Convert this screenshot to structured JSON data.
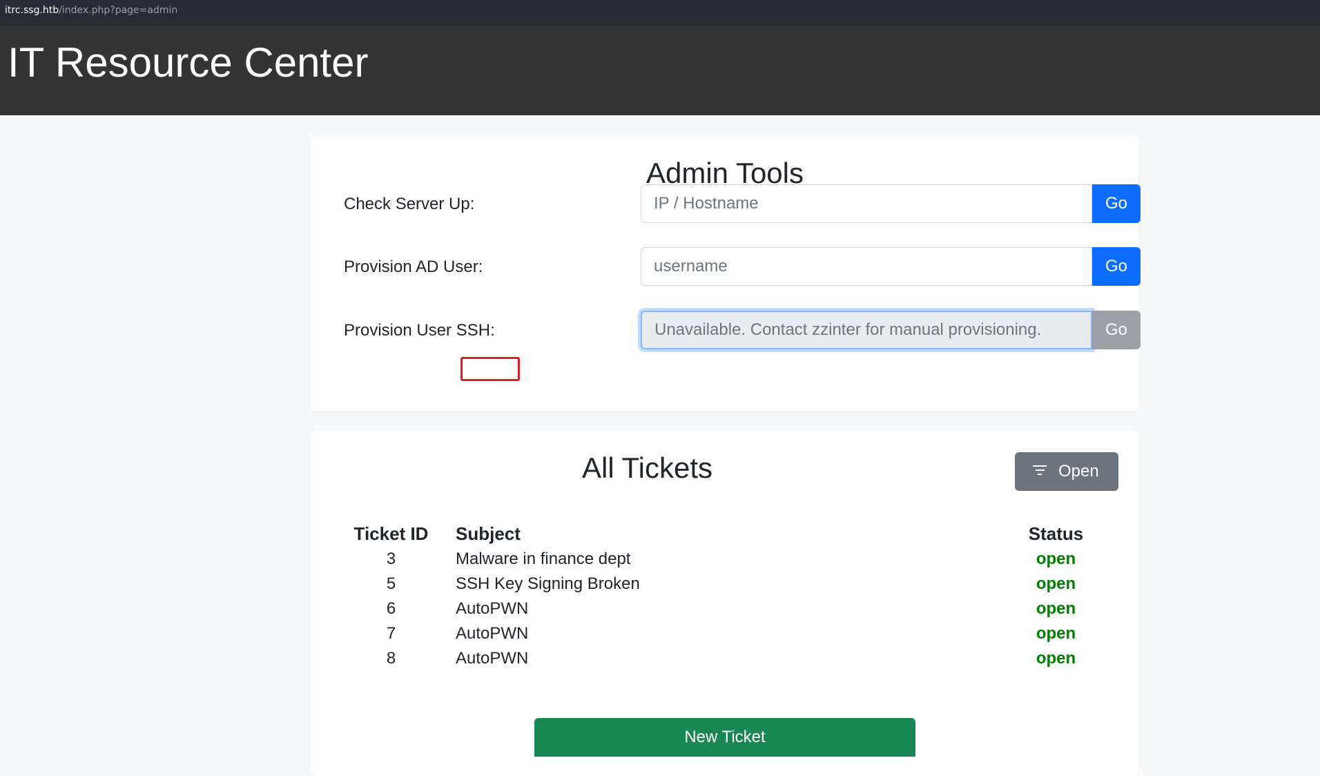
{
  "browser": {
    "url_host": "itrc.ssg.htb",
    "url_path": "/index.php?page=admin"
  },
  "header": {
    "title": "IT Resource Center"
  },
  "admin_tools": {
    "title": "Admin Tools",
    "rows": [
      {
        "label": "Check Server Up:",
        "placeholder": "IP / Hostname",
        "button": "Go"
      },
      {
        "label": "Provision AD User:",
        "placeholder": "username",
        "button": "Go"
      },
      {
        "label": "Provision User SSH:",
        "placeholder": "Unavailable. Contact zzinter for manual provisioning.",
        "button": "Go"
      }
    ]
  },
  "tickets": {
    "title": "All Tickets",
    "filter_label": "Open",
    "columns": [
      "Ticket ID",
      "Subject",
      "Status"
    ],
    "rows": [
      {
        "id": "3",
        "subject": "Malware in finance dept",
        "status": "open"
      },
      {
        "id": "5",
        "subject": "SSH Key Signing Broken",
        "status": "open"
      },
      {
        "id": "6",
        "subject": "AutoPWN",
        "status": "open"
      },
      {
        "id": "7",
        "subject": "AutoPWN",
        "status": "open"
      },
      {
        "id": "8",
        "subject": "AutoPWN",
        "status": "open"
      }
    ],
    "new_ticket_label": "New Ticket"
  },
  "colors": {
    "header_bg": "#343434",
    "primary": "#0d6efd",
    "success": "#198754",
    "status_open": "#008000",
    "annotation": "#e01c1c"
  },
  "icons": {
    "filter": "filter-lines-icon"
  }
}
